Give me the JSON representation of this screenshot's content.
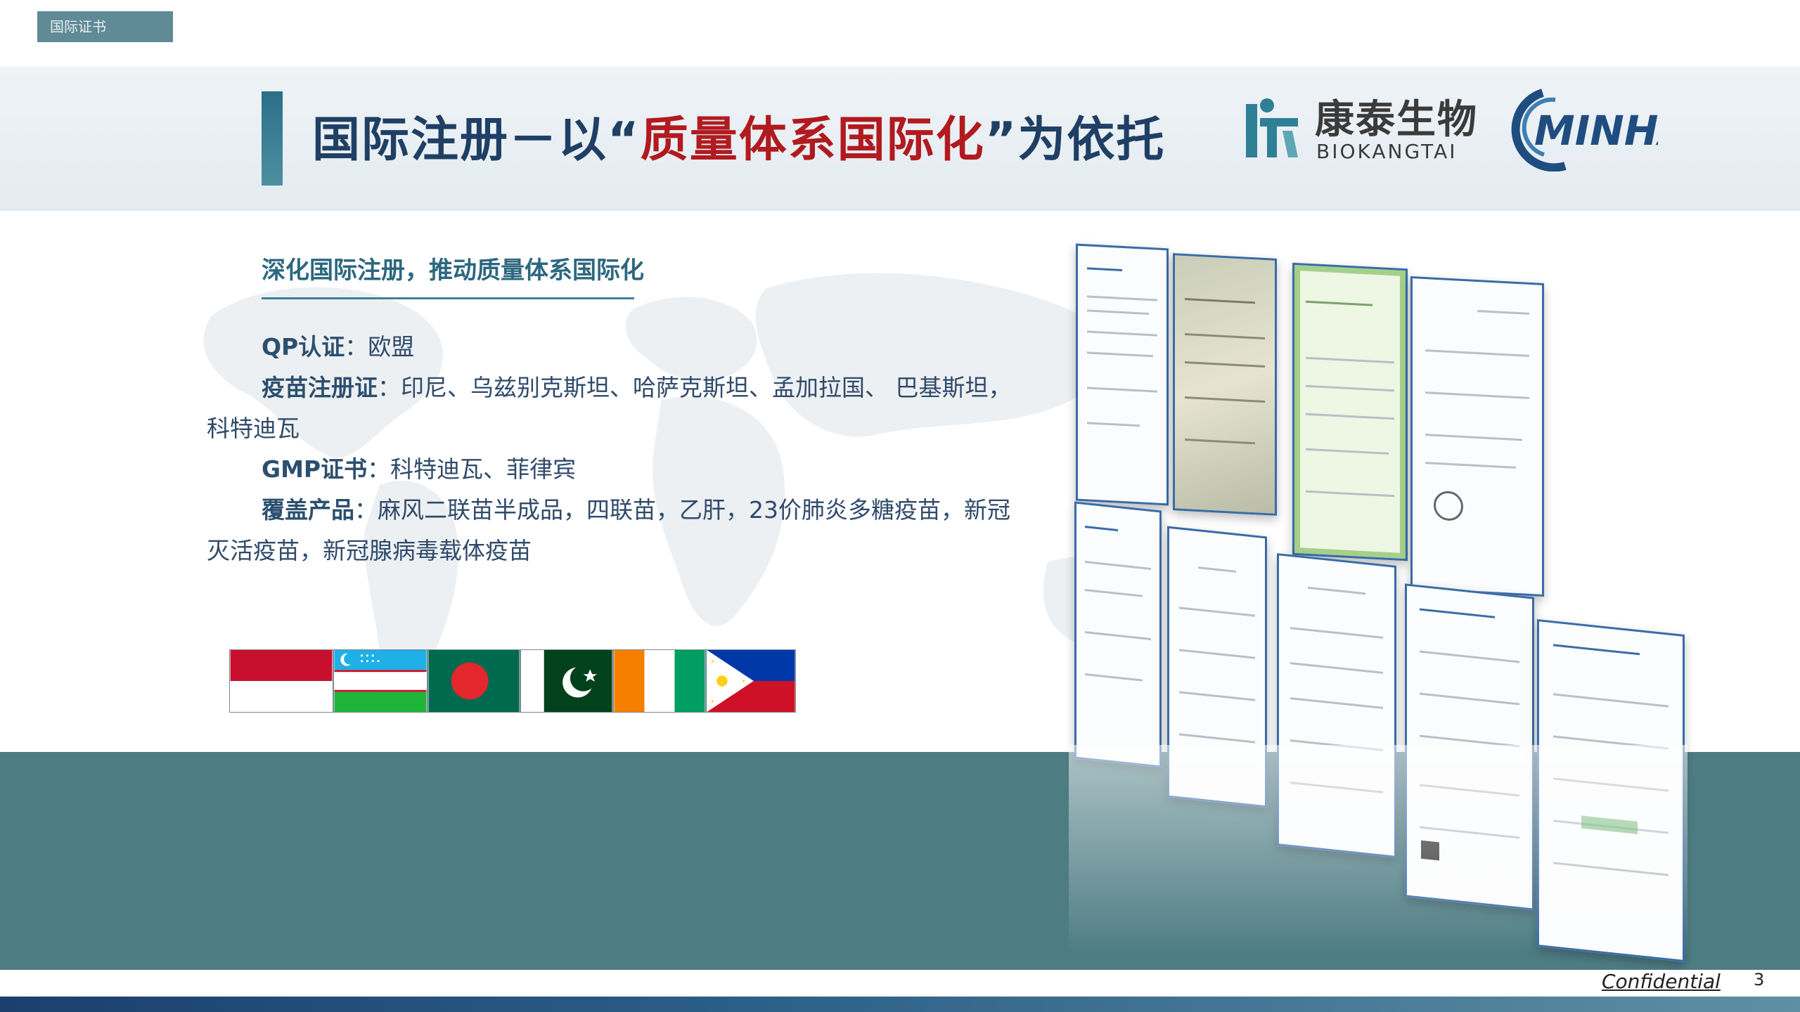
{
  "section_tag": "国际证书",
  "title": {
    "prefix": "国际注册－以“",
    "highlight": "质量体系国际化",
    "suffix": "”为依托"
  },
  "logos": {
    "biokangtai_cn": "康泰生物",
    "biokangtai_en": "BIOKANGTAI",
    "minhai": "MINHAI"
  },
  "content": {
    "subtitle": "深化国际注册，推动质量体系国际化",
    "qp_label": "QP认证",
    "qp_value": "：欧盟",
    "vaccine_label": "疫苗注册证",
    "vaccine_value_line1": "：印尼、乌兹别克斯坦、哈萨克斯坦、孟加拉国、  巴基斯坦，",
    "vaccine_value_line2": "科特迪瓦",
    "gmp_label": "GMP证书",
    "gmp_value": "：科特迪瓦、菲律宾",
    "products_label": "覆盖产品",
    "products_value_line1": "：麻风二联苗半成品，四联苗，乙肝，23价肺炎多糖疫苗，新冠",
    "products_value_line2": "灭活疫苗，新冠腺病毒载体疫苗"
  },
  "flags": [
    "indonesia-flag",
    "uzbekistan-flag",
    "bangladesh-flag",
    "pakistan-flag",
    "ivory-coast-flag",
    "philippines-flag"
  ],
  "footer": {
    "confidential": "Confidential",
    "page_number": "3"
  },
  "colors": {
    "title_blue": "#1f3f64",
    "title_red": "#b11a1f",
    "teal_band": "#4d7c83",
    "subtitle_teal": "#2c6780"
  }
}
